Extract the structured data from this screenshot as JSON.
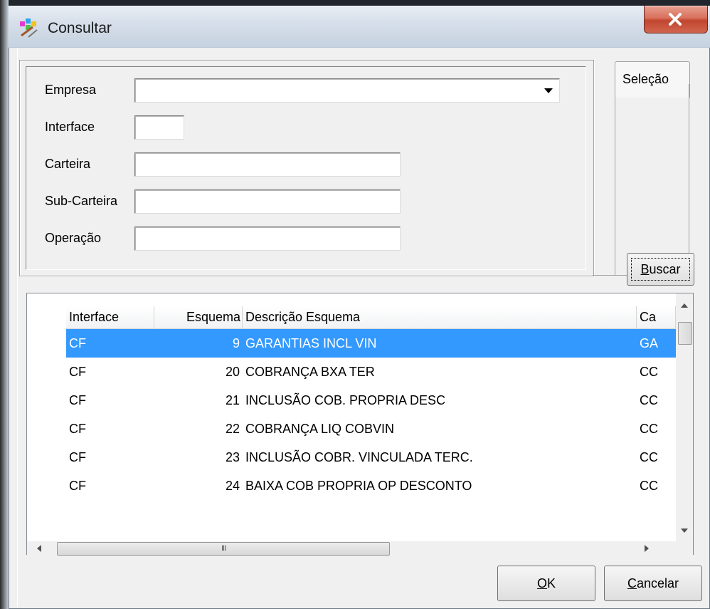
{
  "window": {
    "title": "Consultar"
  },
  "form": {
    "empresa_label": "Empresa",
    "empresa_value": "",
    "interface_label": "Interface",
    "interface_value": "",
    "carteira_label": "Carteira",
    "carteira_value": "",
    "subcarteira_label": "Sub-Carteira",
    "subcarteira_value": "",
    "operacao_label": "Operação",
    "operacao_value": ""
  },
  "tab": {
    "label": "Seleção"
  },
  "buttons": {
    "buscar_accel": "B",
    "buscar_rest": "uscar",
    "ok_accel": "O",
    "ok_rest": "K",
    "cancel_accel": "C",
    "cancel_rest": "ancelar"
  },
  "grid": {
    "columns": [
      "Interface",
      "Esquema",
      "Descrição Esquema",
      "Ca"
    ],
    "rows": [
      {
        "interface": "CF",
        "esquema": "9",
        "descricao": "GARANTIAS INCL VIN",
        "ca": "GA",
        "selected": true
      },
      {
        "interface": "CF",
        "esquema": "20",
        "descricao": "COBRANÇA BXA TER",
        "ca": "CC"
      },
      {
        "interface": "CF",
        "esquema": "21",
        "descricao": "INCLUSÃO COB. PROPRIA DESC",
        "ca": "CC"
      },
      {
        "interface": "CF",
        "esquema": "22",
        "descricao": "COBRANÇA LIQ COBVIN",
        "ca": "CC"
      },
      {
        "interface": "CF",
        "esquema": "23",
        "descricao": "INCLUSÃO COBR. VINCULADA TERC.",
        "ca": "CC"
      },
      {
        "interface": "CF",
        "esquema": "24",
        "descricao": "BAIXA COB PROPRIA OP DESCONTO",
        "ca": "CC"
      }
    ],
    "hscroll_grip": "III"
  },
  "colors": {
    "selection": "#3399ff",
    "close_button": "#c9503a"
  }
}
